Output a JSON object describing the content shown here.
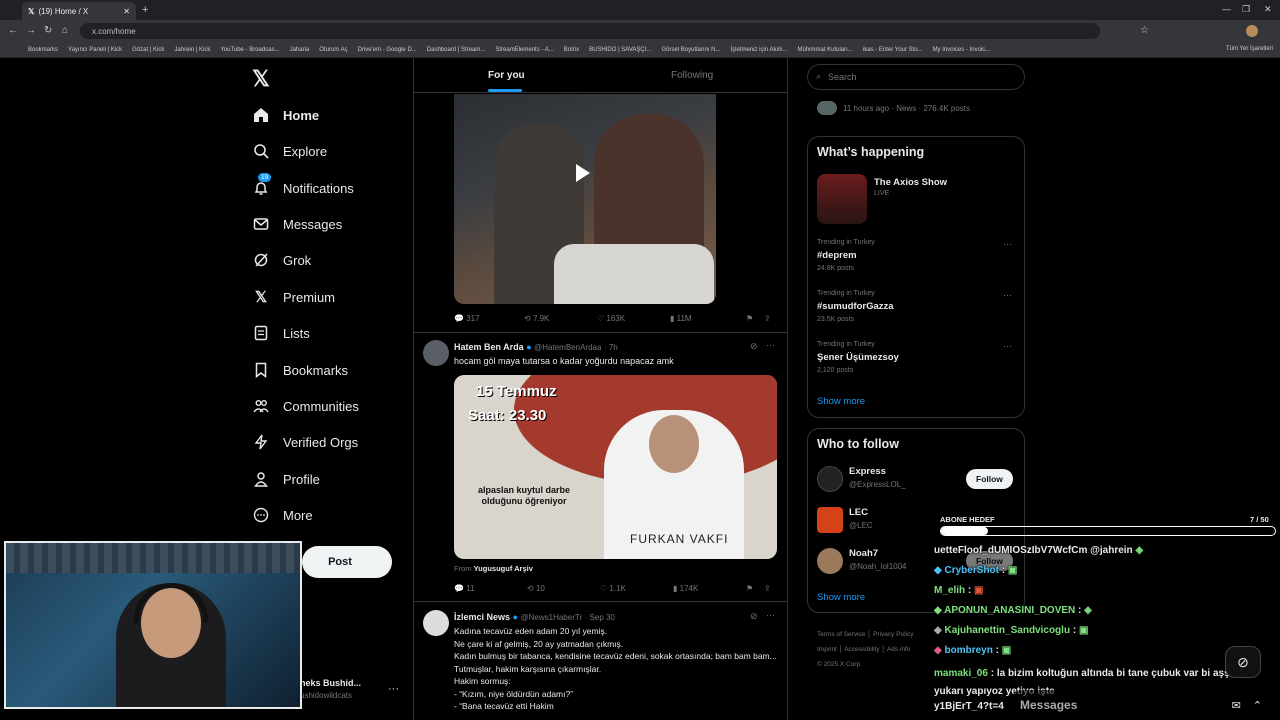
{
  "browser": {
    "tab_title": "(19) Home / X",
    "url": "x.com/home",
    "bookmarks": [
      "Bookmarks",
      "Yayıncı Paneli | Kick",
      "Gözat | Kick",
      "Jahrein | Kick",
      "YouTube - Broadcas...",
      "Jaharia",
      "Oturum Aç",
      "Drive'em - Google D...",
      "Dashboard | Stream...",
      "StreamElements - A...",
      "Botrix",
      "BUSHIDO | SAVAŞÇI...",
      "Görsel Boyutlarını N...",
      "İşletmeniz için Akıllı...",
      "Mühimmat Kutuları...",
      "ikas - Enter Your Sto...",
      "My Invoices - Invoic..."
    ],
    "all_bookmarks": "Tüm Yer İşaretleri"
  },
  "nav": {
    "items": [
      {
        "label": "Home",
        "icon": "home-icon"
      },
      {
        "label": "Explore",
        "icon": "search-icon"
      },
      {
        "label": "Notifications",
        "icon": "bell-icon",
        "badge": "19"
      },
      {
        "label": "Messages",
        "icon": "envelope-icon"
      },
      {
        "label": "Grok",
        "icon": "grok-icon"
      },
      {
        "label": "Premium",
        "icon": "x-logo-icon"
      },
      {
        "label": "Lists",
        "icon": "list-icon"
      },
      {
        "label": "Bookmarks",
        "icon": "bookmark-icon"
      },
      {
        "label": "Communities",
        "icon": "people-icon"
      },
      {
        "label": "Verified Orgs",
        "icon": "lightning-icon"
      },
      {
        "label": "Profile",
        "icon": "person-icon"
      },
      {
        "label": "More",
        "icon": "more-circle-icon"
      }
    ],
    "post_label": "Post",
    "account_name": "neks Bushid...",
    "account_handle": "ushidowildcats"
  },
  "tabs": {
    "for_you": "For you",
    "following": "Following"
  },
  "tweet1": {
    "replies": "317",
    "reposts": "7.9K",
    "likes": "163K",
    "views": "11M"
  },
  "tweet2": {
    "name": "Hatem Ben Arda",
    "handle": "@HatemBenArdaa",
    "time": "· 7h",
    "text": "hocam göl maya tutarsa o kadar yoğurdu napacaz amk",
    "img_date": "15 Temmuz",
    "img_time": "Saat: 23.30",
    "img_caption": "alpaslan kuytul darbe olduğunu öğreniyor",
    "img_banner": "FURKAN VAKFI",
    "from_label": "From",
    "from_name": "Yugusuguf Arşiv",
    "replies": "11",
    "reposts": "10",
    "likes": "1.1K",
    "views": "174K"
  },
  "tweet3": {
    "name": "İzlemci News",
    "handle": "@News1HaberTr",
    "time": "· Sep 30",
    "lines": [
      "Kadına tecavüz eden adam 20 yıl yemiş.",
      "Ne çare ki af gelmiş, 20 ay yatmadan çıkmış.",
      "Kadın bulmuş bir tabanca, kendisine tecavüz edeni, sokak ortasında; bam bam bam...",
      "Tutmuşlar, hakim karşısına çıkarmışlar.",
      "Hakim sormuş:",
      "- “Kızım, niye öldürdün adamı?”",
      "- “Bana tecavüz etti Hakim"
    ]
  },
  "right": {
    "search_placeholder": "Search",
    "top_meta": "11 hours ago · News · 276.4K posts",
    "happening_title": "What’s happening",
    "live_title": "The Axios Show",
    "live_label": "LIVE",
    "trends": [
      {
        "category": "Trending in Turkey",
        "name": "#deprem",
        "posts": "24.8K posts"
      },
      {
        "category": "Trending in Turkey",
        "name": "#sumudforGazza",
        "posts": "23.5K posts"
      },
      {
        "category": "Trending in Turkey",
        "name": "Şener Üşümezsoy",
        "posts": "2,120 posts"
      }
    ],
    "show_more": "Show more",
    "wtf_title": "Who to follow",
    "follows": [
      {
        "name": "Express",
        "handle": "@ExpressLOL_"
      },
      {
        "name": "LEC",
        "handle": "@LEC"
      },
      {
        "name": "Noah7",
        "handle": "@Noah_lol1004"
      }
    ],
    "follow_label": "Follow",
    "show_more2": "Show more",
    "footer": [
      "Terms of Service",
      "Privacy Policy",
      "Cookie Policy",
      "Imprint",
      "Accessibility",
      "Ads info",
      "More ...",
      "© 2025 X Corp."
    ]
  },
  "chat": {
    "abone_label": "ABONE HEDEF",
    "abone_count": "7 / 50",
    "lines": [
      {
        "user": "uetteFloof_dUMIOSzIbV7WcfCm @jahrein",
        "color": "#e7e9ea",
        "msg": ""
      },
      {
        "user": "CryberShot",
        "color": "#4fc3f7",
        "msg": ":"
      },
      {
        "user": "M_elih",
        "color": "#7ee07e",
        "msg": ":"
      },
      {
        "user": "APONUN_ANASINI_DOVEN",
        "color": "#7ee07e",
        "msg": ":"
      },
      {
        "user": "Kajuhanettin_Sandvicoglu",
        "color": "#7ee07e",
        "msg": ":"
      },
      {
        "user": "bombreyn",
        "color": "#4fc3f7",
        "msg": ":"
      },
      {
        "user": "mamaki_06",
        "color": "#7ee07e",
        "msg": ": la bizim koltuğun altında bi tane çubuk var bi aşşa bi yukarı yapıyoz yetiyo işte"
      },
      {
        "user": "y1BjErT_4?t=4",
        "color": "#e7e9ea",
        "msg": ""
      }
    ],
    "messages_label": "Messages"
  }
}
